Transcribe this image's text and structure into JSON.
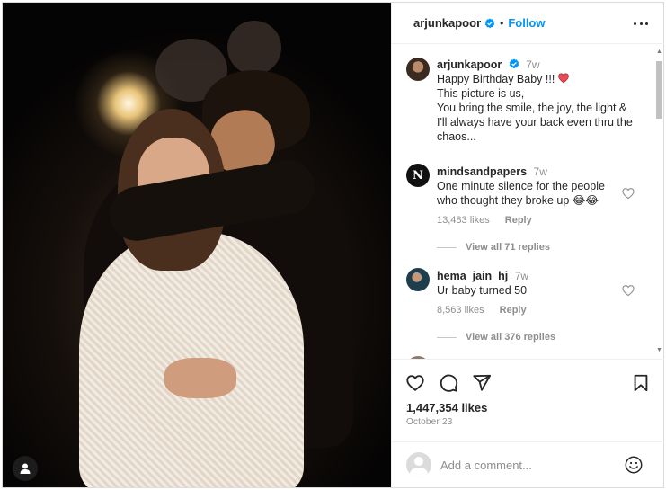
{
  "header": {
    "username": "arjunkapoor",
    "separator": "•",
    "follow_label": "Follow"
  },
  "caption": {
    "username": "arjunkapoor",
    "time": "7w",
    "lines": [
      "Happy Birthday Baby !!!",
      "This picture is us,",
      "You bring the smile, the joy, the light &",
      "I'll always have your back even thru the",
      "chaos..."
    ],
    "emoji_icon": "red-heart-emoji"
  },
  "comments": [
    {
      "username": "mindsandpapers",
      "time": "7w",
      "text_line1": "One minute silence for the people",
      "text_line2": "who thought they broke up 😂😂",
      "likes": "13,483 likes",
      "reply": "Reply",
      "view_replies": "View all 71 replies",
      "avatar_letter": "N"
    },
    {
      "username": "hema_jain_hj",
      "time": "7w",
      "text_line1": "Ur baby turned 50",
      "likes": "8,563 likes",
      "reply": "Reply",
      "view_replies": "View all 376 replies"
    }
  ],
  "post": {
    "likes": "1,447,354 likes",
    "date": "October 23"
  },
  "add_comment": {
    "placeholder": "Add a comment..."
  },
  "colors": {
    "accent": "#0095f6",
    "verified": "#0095f6",
    "heart_emoji": "#ed4956"
  }
}
